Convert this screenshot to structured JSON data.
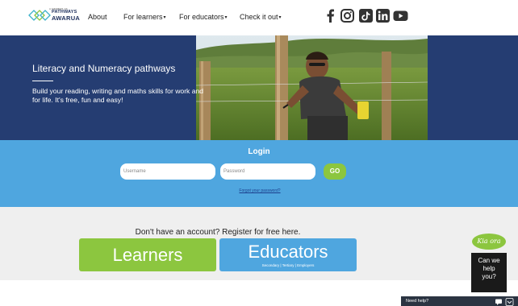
{
  "header": {
    "logo_small": "A MEMBER OF",
    "logo_line1": "PATHWAYS",
    "logo_line2": "AWARUA",
    "nav": [
      {
        "label": "About",
        "caret": ""
      },
      {
        "label": "For learners",
        "caret": "▾"
      },
      {
        "label": "For educators",
        "caret": "▾"
      },
      {
        "label": "Check it out",
        "caret": "▾"
      }
    ],
    "social": [
      "facebook-icon",
      "instagram-icon",
      "tiktok-icon",
      "linkedin-icon",
      "youtube-icon"
    ]
  },
  "hero": {
    "title": "Literacy and Numeracy pathways",
    "subtitle": "Build your reading, writing and maths skills for work and for life. It's free, fun and easy!"
  },
  "login": {
    "title": "Login",
    "username_placeholder": "Username",
    "password_placeholder": "Password",
    "go_label": "GO",
    "forgot_label": "Forgot your password?"
  },
  "register": {
    "prompt": "Don't have an account? Register for free here.",
    "learners_label": "Learners",
    "educators_label": "Educators",
    "educators_sub": "Secondary | Tertiary | Employers"
  },
  "chat": {
    "greeting": "Kia ora",
    "line1": "Can we",
    "line2": "help",
    "line3": "you?",
    "need_help": "Need help?"
  },
  "colors": {
    "navy": "#253d72",
    "blue": "#4fa6df",
    "green": "#8cc63f",
    "grey": "#efefef"
  }
}
